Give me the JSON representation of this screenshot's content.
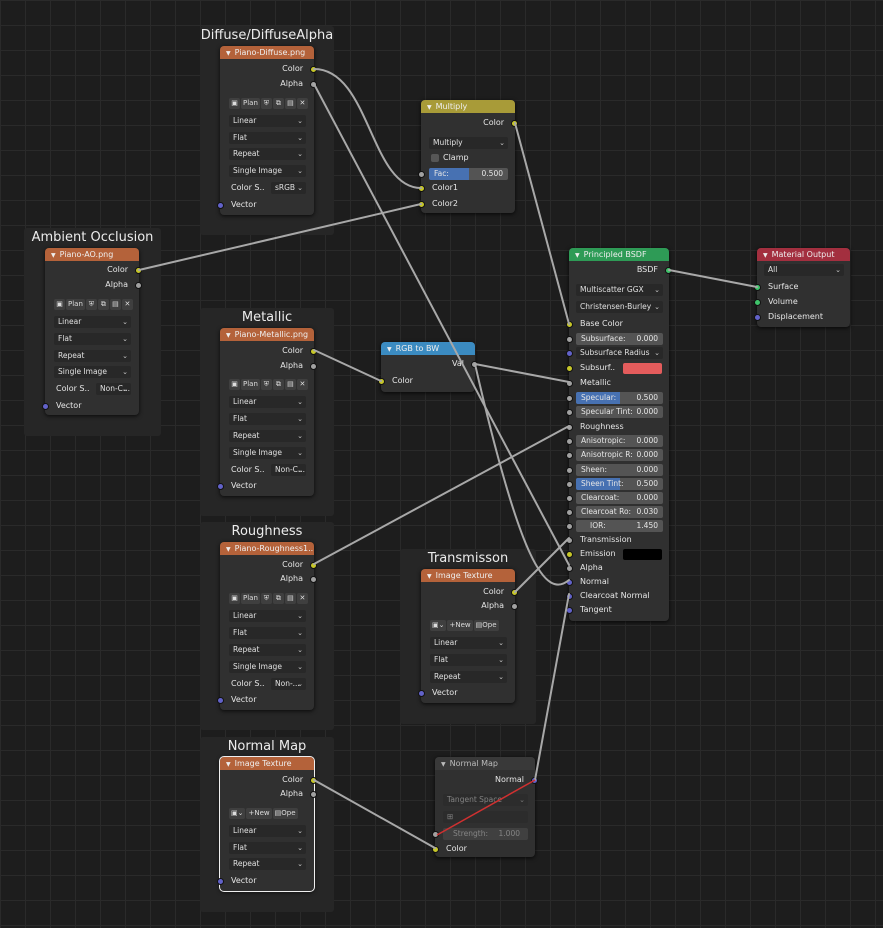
{
  "frames": {
    "diffuse": "Diffuse/DiffuseAlpha",
    "ao": "Ambient Occlusion",
    "metallic": "Metallic",
    "roughness": "Roughness",
    "transmission": "Transmisson",
    "normal": "Normal Map"
  },
  "sockets": {
    "color": "Color",
    "alpha": "Alpha",
    "vector": "Vector",
    "color1": "Color1",
    "color2": "Color2",
    "bsdf": "BSDF",
    "val": "Val",
    "normal": "Normal"
  },
  "image_node": {
    "interp": "Linear",
    "projection": "Flat",
    "extension": "Repeat",
    "source": "Single Image",
    "colorspace_label": "Color S..",
    "plan": "Plan",
    "new": "New",
    "open": "Ope"
  },
  "tex_diffuse": {
    "title": "Piano-Diffuse.png",
    "colorspace": "sRGB"
  },
  "tex_ao": {
    "title": "Piano-AO.png",
    "colorspace": "Non-C..."
  },
  "tex_metallic": {
    "title": "Piano-Metallic.png",
    "colorspace": "Non-C..."
  },
  "tex_roughness": {
    "title": "Piano-Roughness1...",
    "colorspace": "Non-..."
  },
  "tex_transmission": {
    "title": "Image Texture"
  },
  "tex_normal": {
    "title": "Image Texture"
  },
  "multiply": {
    "title": "Multiply",
    "blend": "Multiply",
    "clamp": "Clamp",
    "fac_label": "Fac:",
    "fac_value": "0.500",
    "fac_fraction": 0.5
  },
  "rgb2bw": {
    "title": "RGB to BW"
  },
  "normal_map": {
    "title": "Normal Map",
    "space": "Tangent Space",
    "uv": "",
    "strength_label": "Strength:",
    "strength_value": "1.000"
  },
  "bsdf": {
    "title": "Principled BSDF",
    "distribution": "Multiscatter GGX",
    "subsurface_method": "Christensen-Burley",
    "base_color": "Base Color",
    "subsurface_label": "Subsurface:",
    "subsurface_value": "0.000",
    "subsurface_radius": "Subsurface Radius",
    "subsurface_color": "Subsurf..",
    "subsurface_color_hex": "#e45c5c",
    "metallic": "Metallic",
    "specular_label": "Specular:",
    "specular_value": "0.500",
    "specular_fraction": 0.5,
    "spec_tint_label": "Specular Tint:",
    "spec_tint_value": "0.000",
    "roughness": "Roughness",
    "aniso_label": "Anisotropic:",
    "aniso_value": "0.000",
    "aniso_rot_label": "Anisotropic R:",
    "aniso_rot_value": "0.000",
    "sheen_label": "Sheen:",
    "sheen_value": "0.000",
    "sheen_tint_label": "Sheen Tint:",
    "sheen_tint_value": "0.500",
    "sheen_tint_fraction": 0.5,
    "clearcoat_label": "Clearcoat:",
    "clearcoat_value": "0.000",
    "clearcoat_rough_label": "Clearcoat Ro:",
    "clearcoat_rough_value": "0.030",
    "ior_label": "IOR:",
    "ior_value": "1.450",
    "transmission": "Transmission",
    "emission": "Emission",
    "emission_hex": "#000000",
    "alpha": "Alpha",
    "normal": "Normal",
    "clearcoat_normal": "Clearcoat Normal",
    "tangent": "Tangent"
  },
  "output": {
    "title": "Material Output",
    "target": "All",
    "surface": "Surface",
    "volume": "Volume",
    "displacement": "Displacement"
  },
  "colors": {
    "texture_header": "#b4623a",
    "mix_header": "#a89b38",
    "converter_header": "#3b8bc1",
    "shader_header": "#2e9b56",
    "output_header": "#a32f3f",
    "wire": "#a8a8a8",
    "wire_error": "#d03030"
  }
}
